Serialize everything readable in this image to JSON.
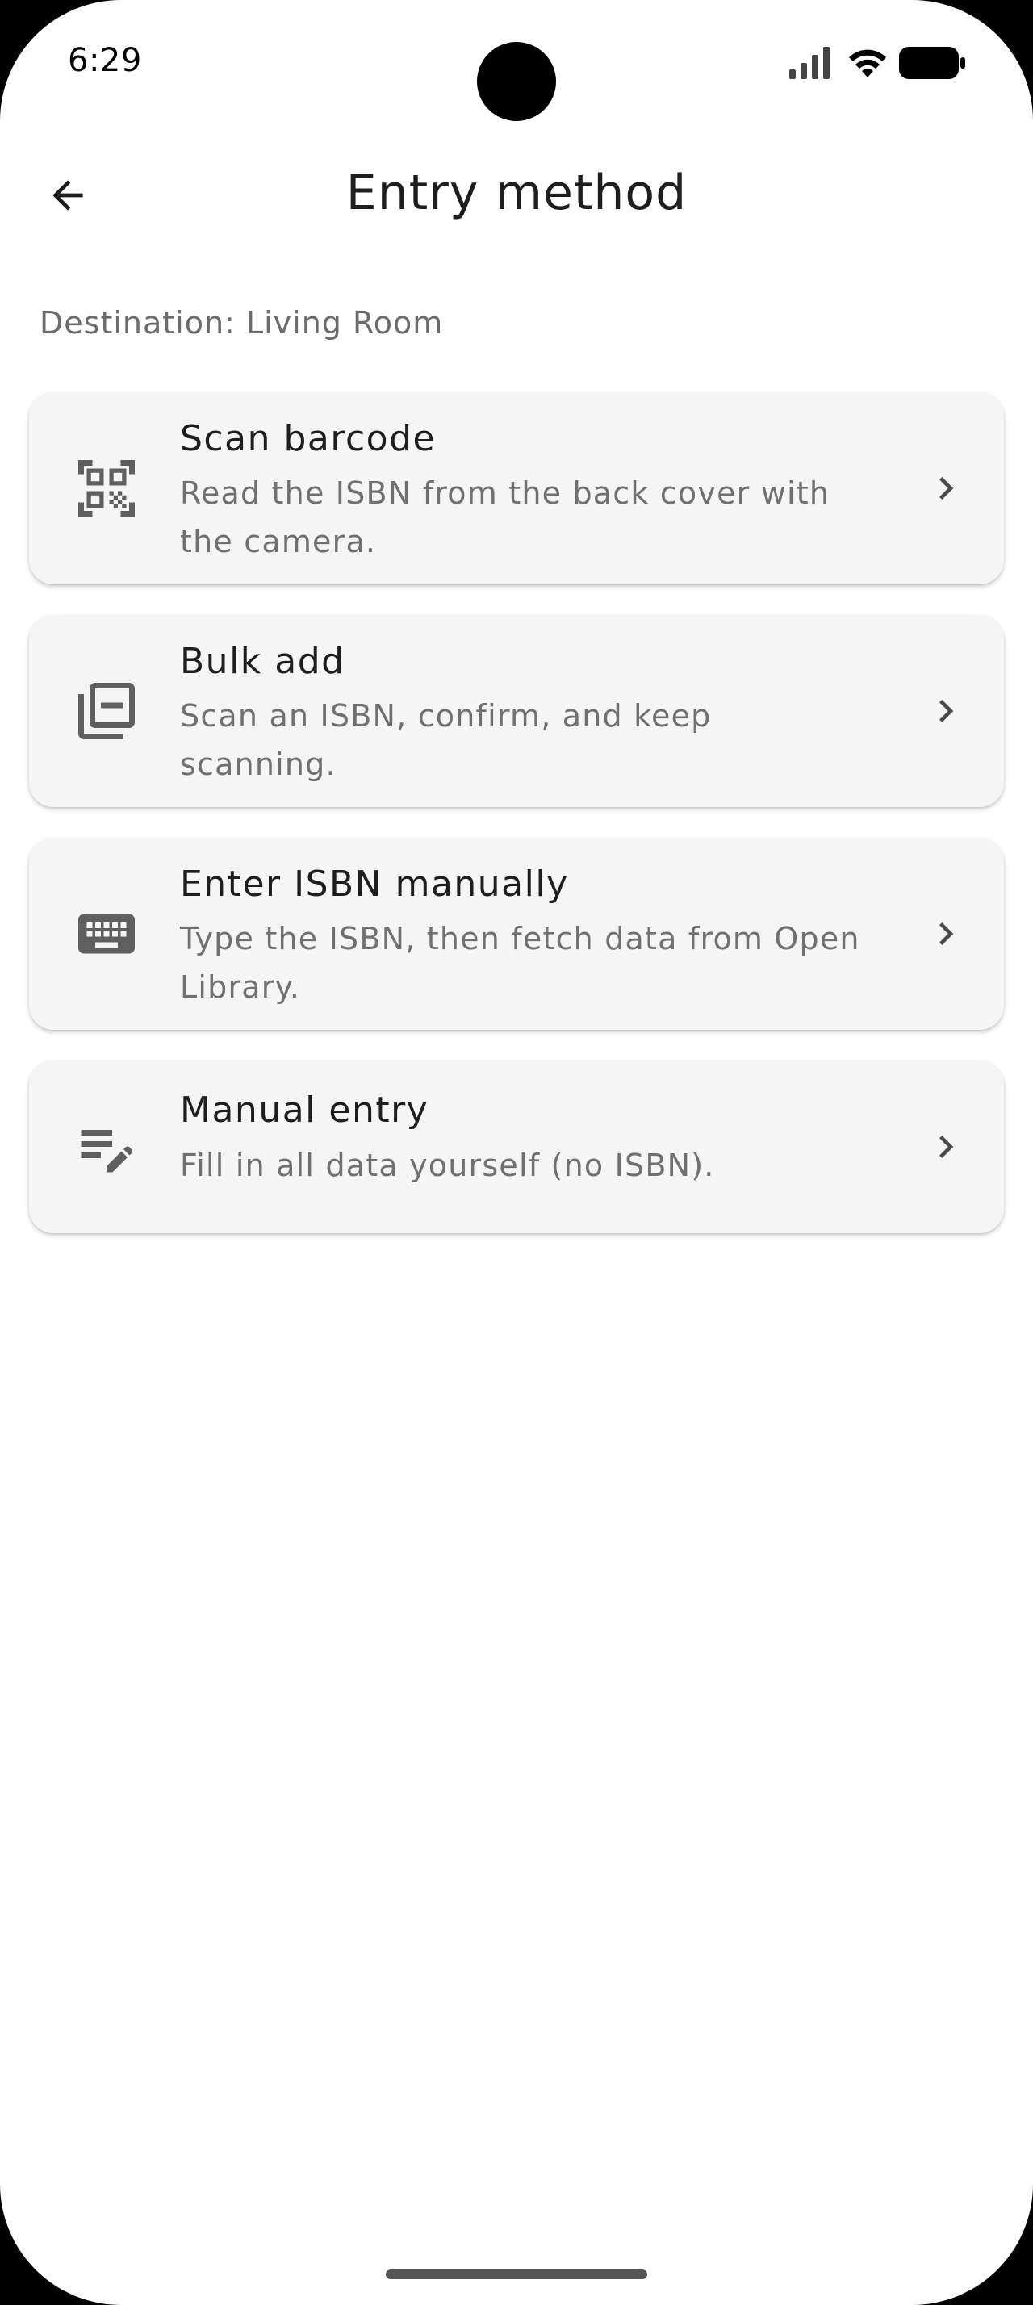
{
  "status_bar": {
    "time": "6:29",
    "icons": [
      "signal-icon",
      "wifi-icon",
      "battery-icon"
    ]
  },
  "app_bar": {
    "back_icon": "arrow-back-icon",
    "title": "Entry method"
  },
  "destination": "Destination: Living Room",
  "options": [
    {
      "icon": "qr-code-scanner-icon",
      "title": "Scan barcode",
      "subtitle": "Read the ISBN from the back cover with the camera."
    },
    {
      "icon": "library-add-icon",
      "title": "Bulk add",
      "subtitle": "Scan an ISBN, confirm, and keep scanning."
    },
    {
      "icon": "keyboard-icon",
      "title": "Enter ISBN manually",
      "subtitle": "Type the ISBN, then fetch data from Open Library."
    },
    {
      "icon": "edit-note-icon",
      "title": "Manual entry",
      "subtitle": "Fill in all data yourself (no ISBN)."
    }
  ],
  "colors": {
    "icon": "#5f5f5f",
    "card_background": "#f5f5f5",
    "subtitle": "#707070"
  }
}
